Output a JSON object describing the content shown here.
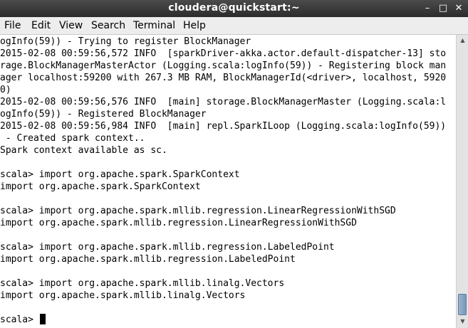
{
  "window": {
    "title": "cloudera@quickstart:~",
    "controls": {
      "minimize": "–",
      "maximize": "□",
      "close": "✕"
    }
  },
  "menu": {
    "items": [
      "File",
      "Edit",
      "View",
      "Search",
      "Terminal",
      "Help"
    ]
  },
  "terminal": {
    "lines": [
      "ogInfo(59)) - Trying to register BlockManager",
      "2015-02-08 00:59:56,572 INFO  [sparkDriver-akka.actor.default-dispatcher-13] sto",
      "rage.BlockManagerMasterActor (Logging.scala:logInfo(59)) - Registering block man",
      "ager localhost:59200 with 267.3 MB RAM, BlockManagerId(<driver>, localhost, 5920",
      "0)",
      "2015-02-08 00:59:56,576 INFO  [main] storage.BlockManagerMaster (Logging.scala:l",
      "ogInfo(59)) - Registered BlockManager",
      "2015-02-08 00:59:56,984 INFO  [main] repl.SparkILoop (Logging.scala:logInfo(59))",
      " - Created spark context..",
      "Spark context available as sc.",
      "",
      "scala> import org.apache.spark.SparkContext",
      "import org.apache.spark.SparkContext",
      "",
      "scala> import org.apache.spark.mllib.regression.LinearRegressionWithSGD",
      "import org.apache.spark.mllib.regression.LinearRegressionWithSGD",
      "",
      "scala> import org.apache.spark.mllib.regression.LabeledPoint",
      "import org.apache.spark.mllib.regression.LabeledPoint",
      "",
      "scala> import org.apache.spark.mllib.linalg.Vectors",
      "import org.apache.spark.mllib.linalg.Vectors",
      ""
    ],
    "prompt": "scala> "
  },
  "scrollbar": {
    "up_icon": "chevron-up-icon",
    "down_icon": "chevron-down-icon"
  },
  "colors": {
    "titlebar": "#3a3a3a",
    "menubar": "#ededed",
    "background": "#ffffff",
    "text": "#000000",
    "thumb": "#7a98b9"
  }
}
